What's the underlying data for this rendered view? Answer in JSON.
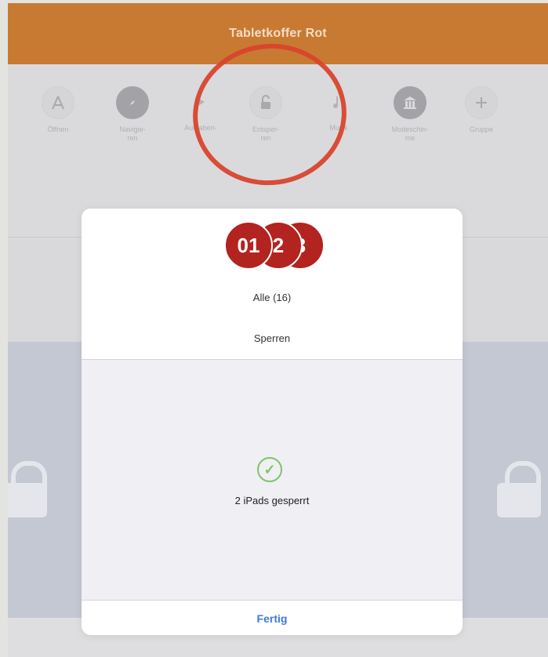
{
  "header": {
    "title": "Tabletkoffer Rot"
  },
  "toolbar": {
    "tools": [
      {
        "label": "Öffnen",
        "icon": "app-store-icon"
      },
      {
        "label": "Navigie-\nren",
        "icon": "compass-icon"
      },
      {
        "label": "Aufgaben-\n...",
        "icon": "forward-icon"
      },
      {
        "label": "Entsper-\nren",
        "icon": "unlock-icon"
      },
      {
        "label": "Musik",
        "icon": "music-icon"
      },
      {
        "label": "Modeschin-\nme",
        "icon": "museum-icon"
      },
      {
        "label": "Gruppe",
        "icon": "plus-icon"
      }
    ]
  },
  "modal": {
    "badges": [
      "01",
      "2",
      "3"
    ],
    "group_label": "Alle (16)",
    "action_label": "Sperren",
    "result_label": "2 iPads gesperrt",
    "done_label": "Fertig"
  },
  "colors": {
    "header": "#c87a33",
    "badge": "#b3231f",
    "highlight_ring": "#d9442d",
    "success": "#7cc46b",
    "link": "#3d7bd6"
  }
}
